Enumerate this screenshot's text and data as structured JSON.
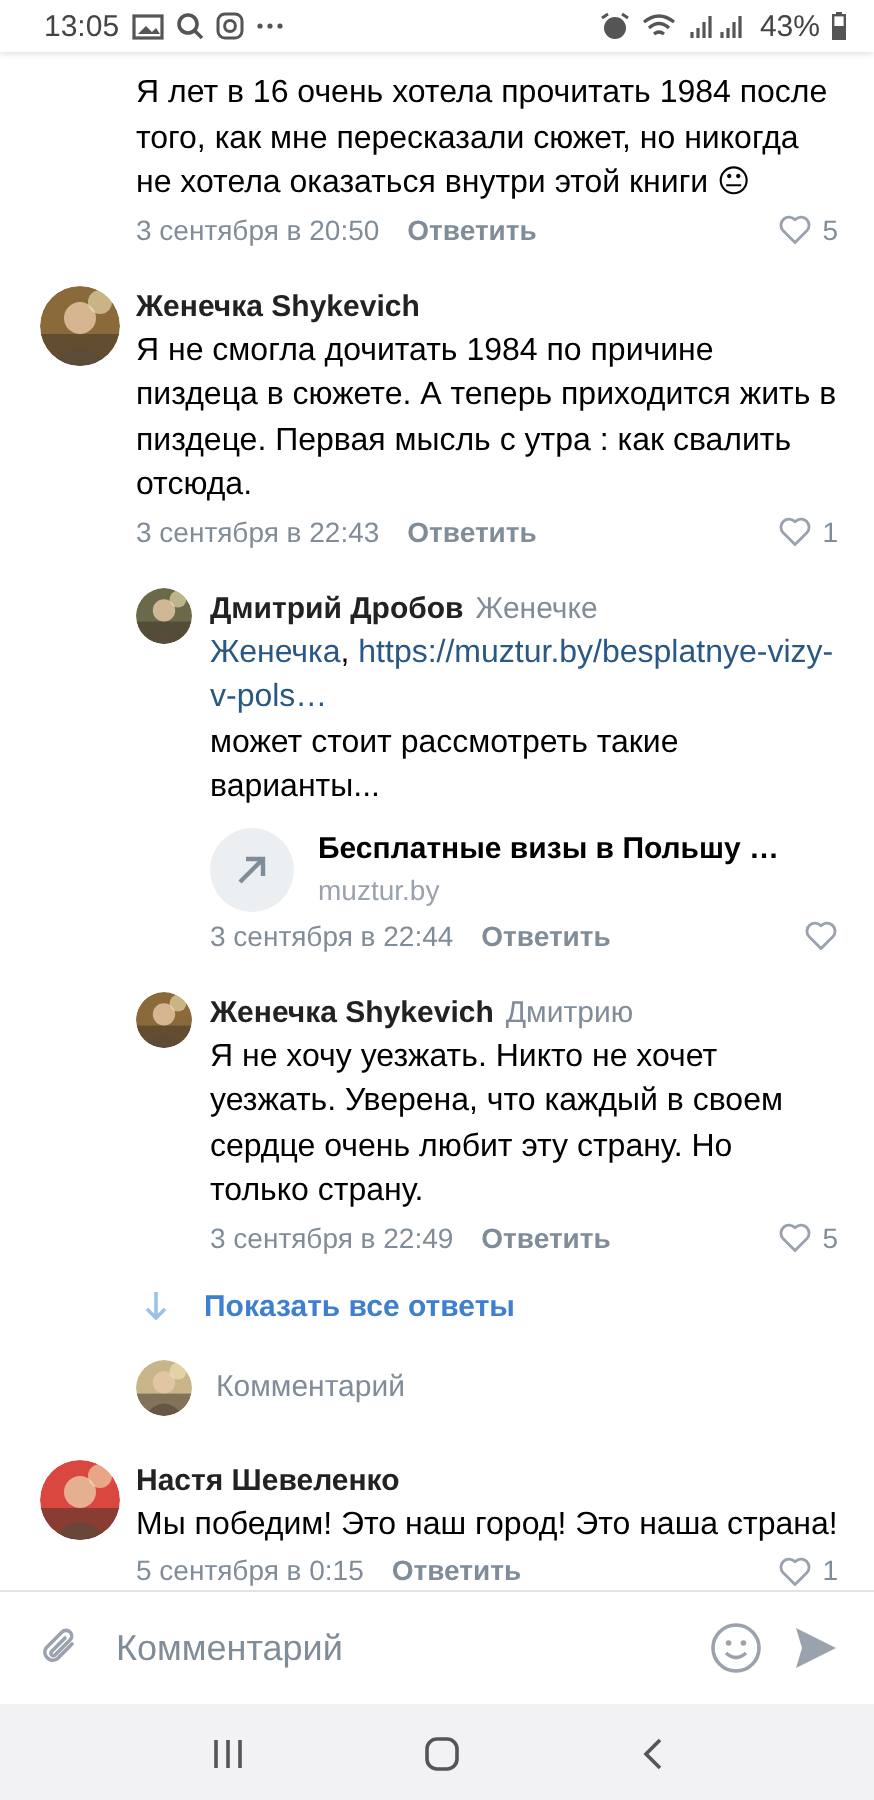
{
  "status_bar": {
    "time": "13:05",
    "battery": "43%"
  },
  "comments": [
    {
      "kind": "tail",
      "text": "Я лет в 16 очень хотела прочитать 1984 после того, как мне пересказали сюжет, но никогда не хотела оказаться внутри этой книги 😐",
      "date": "3 сентября в 20:50",
      "reply_label": "Ответить",
      "likes": "5"
    },
    {
      "kind": "comment",
      "author": "Женечка Shykevich",
      "text": "Я не смогла дочитать 1984 по причине пиздеца в сюжете. А теперь приходится жить в пиздеце. Первая мысль с утра : как свалить отсюда.",
      "date": "3 сентября в 22:43",
      "reply_label": "Ответить",
      "likes": "1"
    },
    {
      "kind": "reply",
      "author": "Дмитрий Дробов",
      "reply_to": "Женечке",
      "parts": [
        {
          "kind": "link",
          "text": "Женечка"
        },
        {
          "kind": "plain",
          "text": ", "
        },
        {
          "kind": "link",
          "text": "https://muztur.by/besplatnye-vizy-v-pols…"
        }
      ],
      "text": "может стоит рассмотреть такие варианты...",
      "link_preview": {
        "title": "Бесплатные визы в Польшу …",
        "domain": "muztur.by"
      },
      "date": "3 сентября в 22:44",
      "reply_label": "Ответить"
    },
    {
      "kind": "reply",
      "author": "Женечка Shykevich",
      "reply_to": "Дмитрию",
      "text": "Я не хочу уезжать. Никто не хочет уезжать. Уверена, что каждый в своем сердце очень любит эту страну. Но только страну.",
      "date": "3 сентября в 22:49",
      "reply_label": "Ответить",
      "likes": "5"
    },
    {
      "kind": "show_all",
      "text": "Показать все ответы"
    },
    {
      "kind": "reply_input",
      "placeholder": "Комментарий"
    },
    {
      "kind": "comment",
      "author": "Настя Шевеленко",
      "text": "Мы победим! Это наш город! Это наша страна!",
      "date": "5 сентября в 0:15",
      "reply_label": "Ответить",
      "likes": "1"
    }
  ],
  "composer": {
    "placeholder": "Комментарий"
  }
}
